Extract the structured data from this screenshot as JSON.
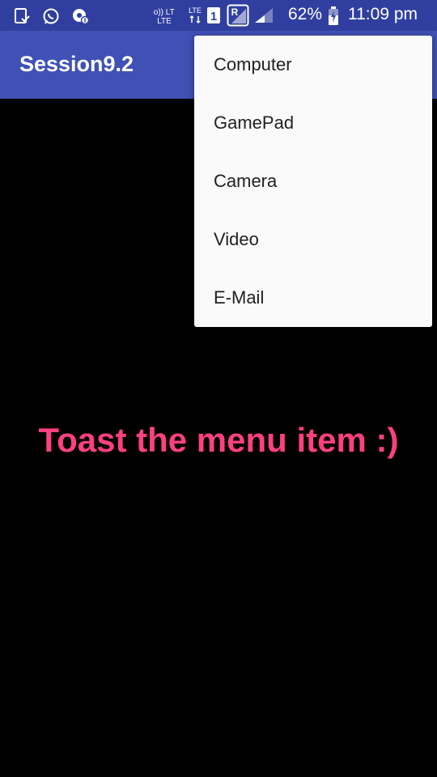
{
  "status_bar": {
    "battery_percent": "62%",
    "time": "11:09 pm",
    "icons": [
      "screenshot-notification-icon",
      "whatsapp-icon",
      "settings-notification-icon",
      "volte-icon",
      "lte-icon",
      "sim1-icon",
      "roaming-icon",
      "signal-icon",
      "battery-charging-icon"
    ],
    "volte_text": "Vo)) LTE",
    "lte_text": "LTE",
    "sim_text": "1",
    "roaming_text": "R"
  },
  "app_bar": {
    "title": "Session9.2"
  },
  "menu": {
    "items": [
      "Computer",
      "GamePad",
      "Camera",
      "Video",
      "E-Mail"
    ]
  },
  "content": {
    "message": "Toast the menu item  :)"
  },
  "colors": {
    "status_bar": "#303F9F",
    "app_bar": "#3F51B5",
    "accent": "#FF4081",
    "menu_background": "#FAFAFA",
    "background": "#000000"
  }
}
